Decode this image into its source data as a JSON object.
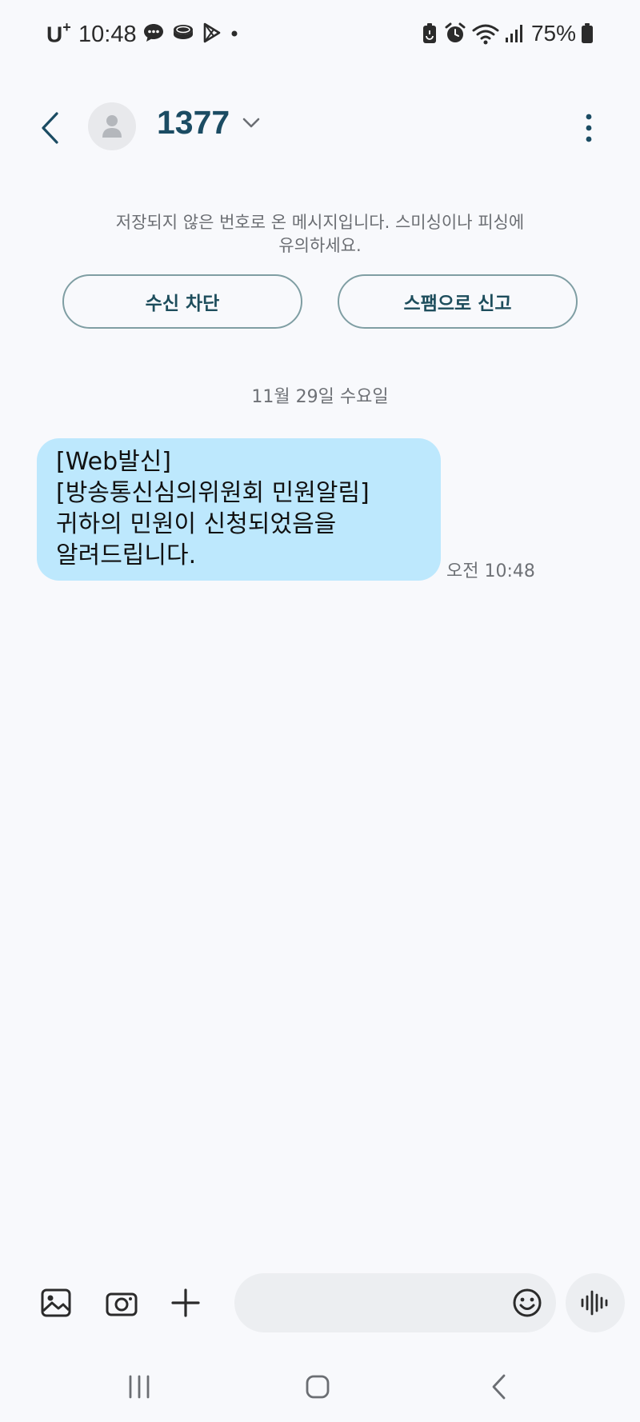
{
  "status_bar": {
    "carrier": "U",
    "carrier_suffix": "+",
    "time": "10:48",
    "battery": "75%"
  },
  "header": {
    "contact_name": "1377"
  },
  "warning": {
    "line1": "저장되지 않은 번호로 온 메시지입니다. 스미싱이나 피싱에",
    "line2": "유의하세요."
  },
  "actions": {
    "block_label": "수신 차단",
    "report_label": "스팸으로 신고"
  },
  "conversation": {
    "date": "11월 29일 수요일",
    "messages": [
      {
        "lines": [
          "[Web발신]",
          "[방송통신심의위원회 민원알림]",
          "귀하의 민원이 신청되었음을",
          "알려드립니다."
        ],
        "time": "오전 10:48"
      }
    ]
  },
  "composer": {
    "placeholder": ""
  },
  "icons": {
    "back": "chevron-left-icon",
    "avatar": "person-icon",
    "more": "more-vertical-icon",
    "gallery": "image-icon",
    "camera": "camera-icon",
    "add": "plus-icon",
    "emoji": "smiley-icon",
    "voice": "waveform-icon"
  },
  "colors": {
    "background": "#f8f9fc",
    "accent": "#1b4c63",
    "bubble": "#bde8fd",
    "pill_border": "#7f9ea3"
  }
}
